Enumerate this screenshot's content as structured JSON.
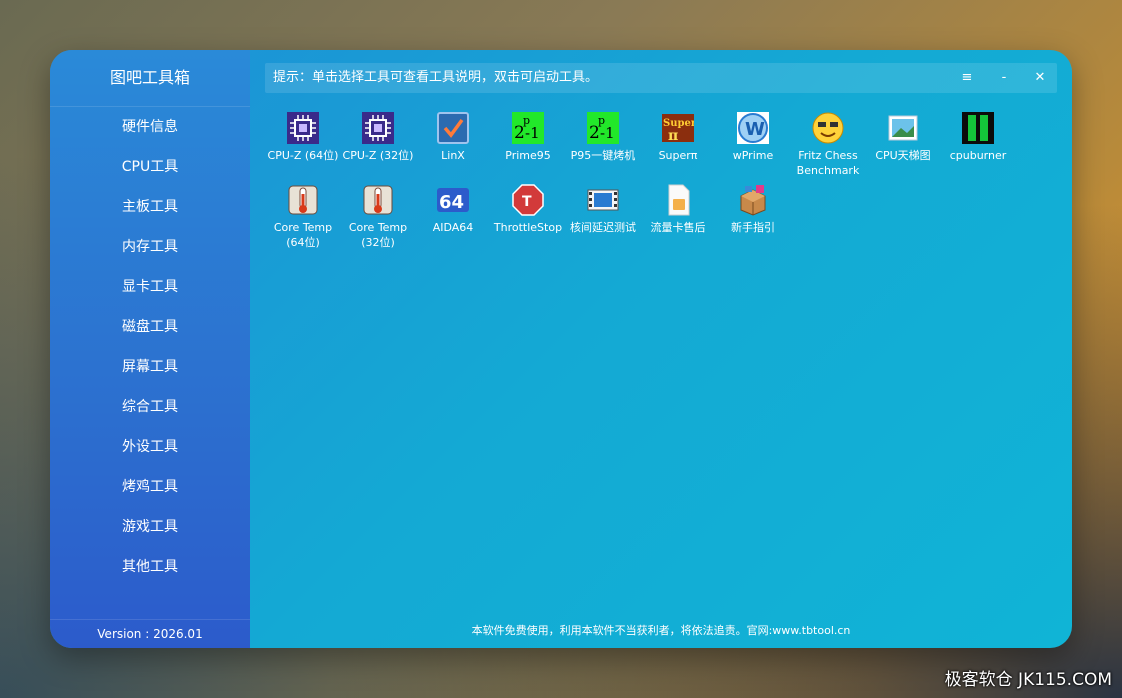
{
  "app": {
    "title": "图吧工具箱",
    "version": "Version : 2026.01",
    "hint": "提示：单击选择工具可查看工具说明，双击可启动工具。",
    "footer": "本软件免费使用，利用本软件不当获利者，将依法追责。官网:www.tbtool.cn"
  },
  "window_controls": {
    "menu": "≡",
    "minimize": "-",
    "close": "✕"
  },
  "sidebar": {
    "items": [
      {
        "label": "硬件信息"
      },
      {
        "label": "CPU工具"
      },
      {
        "label": "主板工具"
      },
      {
        "label": "内存工具"
      },
      {
        "label": "显卡工具"
      },
      {
        "label": "磁盘工具"
      },
      {
        "label": "屏幕工具"
      },
      {
        "label": "综合工具"
      },
      {
        "label": "外设工具"
      },
      {
        "label": "烤鸡工具"
      },
      {
        "label": "游戏工具"
      },
      {
        "label": "其他工具"
      }
    ]
  },
  "tools": [
    {
      "label": "CPU-Z (64位)",
      "icon": "cpu-chip-icon"
    },
    {
      "label": "CPU-Z (32位)",
      "icon": "cpu-chip-icon"
    },
    {
      "label": "LinX",
      "icon": "checkbox-icon"
    },
    {
      "label": "Prime95",
      "icon": "prime-formula-icon"
    },
    {
      "label": "P95一键烤机",
      "icon": "prime-formula-icon"
    },
    {
      "label": "Superπ",
      "icon": "superpi-logo-icon"
    },
    {
      "label": "wPrime",
      "icon": "w-globe-icon"
    },
    {
      "label": "Fritz Chess Benchmark",
      "icon": "smiley-face-icon"
    },
    {
      "label": "CPU天梯图",
      "icon": "picture-icon"
    },
    {
      "label": "cpuburner",
      "icon": "green-bars-icon"
    },
    {
      "label": "Core Temp (64位)",
      "icon": "thermometer-icon"
    },
    {
      "label": "Core Temp (32位)",
      "icon": "thermometer-icon"
    },
    {
      "label": "AIDA64",
      "icon": "aida64-icon"
    },
    {
      "label": "ThrottleStop",
      "icon": "stop-sign-icon"
    },
    {
      "label": "核间延迟测试",
      "icon": "film-strip-icon"
    },
    {
      "label": "流量卡售后",
      "icon": "sim-card-icon"
    },
    {
      "label": "新手指引",
      "icon": "package-box-icon"
    }
  ],
  "watermark": "极客软仓 JK115.COM",
  "colors": {
    "window_blue": "#1e8fd6",
    "sidebar_blue": "#2c6fcf",
    "cpu_chip_purple": "#3a2a8a",
    "prime_green": "#22e82a",
    "stop_red": "#d23a3a"
  }
}
